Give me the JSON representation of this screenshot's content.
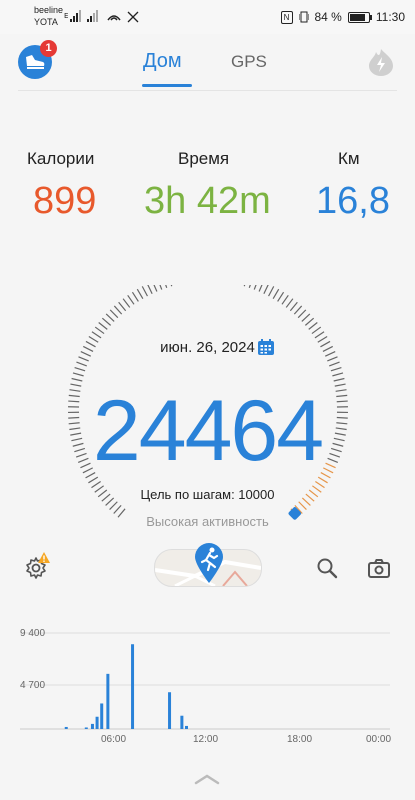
{
  "status_bar": {
    "carrier1": "beeline",
    "carrier2": "YOTA",
    "battery_percent": "84 %",
    "battery_level": 0.84,
    "time": "11:30"
  },
  "nav": {
    "badge": "1",
    "tab_home": "Дом",
    "tab_gps": "GPS"
  },
  "stats": {
    "calories_label": "Калории",
    "calories_value": "899",
    "time_label": "Время",
    "time_value": "3h 42m",
    "km_label": "Км",
    "km_value": "16,8"
  },
  "gauge": {
    "date": "июн. 26, 2024",
    "steps": "24464",
    "goal_text": "Цель по шагам: 10000",
    "activity_level": "Высокая активность"
  },
  "chart_data": {
    "type": "bar",
    "y_ticks": [
      "9 400",
      "4 700"
    ],
    "x_ticks": [
      "06:00",
      "12:00",
      "18:00",
      "00:00"
    ],
    "color": "#2a82d8",
    "x_hours": [
      3.0,
      4.3,
      4.7,
      5.0,
      5.3,
      5.7,
      7.3,
      9.7,
      10.5,
      10.8
    ],
    "values": [
      200,
      150,
      500,
      1200,
      2500,
      5400,
      8300,
      3600,
      1300,
      300
    ],
    "ylim": [
      0,
      9400
    ],
    "xlim": [
      0,
      24
    ]
  }
}
